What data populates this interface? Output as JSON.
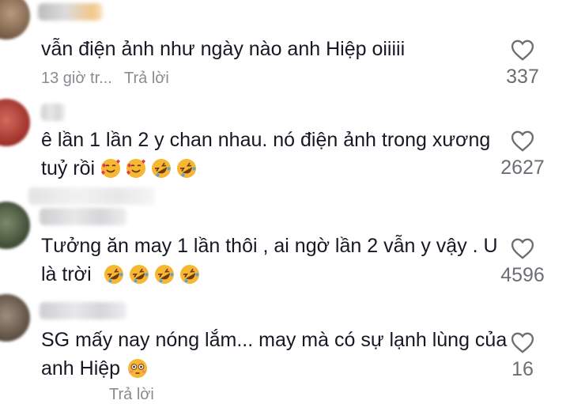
{
  "comments": [
    {
      "text_lines": [
        "vẫn điện ảnh như ngày nào anh Hiệp oiiiii"
      ],
      "time": "13 giờ tr...",
      "reply_label": "Trả lời",
      "likes": "337"
    },
    {
      "text_lines": [
        "ê lần 1 lần 2 y chan nhau. nó điện ảnh trong xương",
        "tuỷ rồi"
      ],
      "emojis": [
        "smiling-face-with-hearts",
        "smiling-face-with-hearts",
        "rolling-on-floor-laughing",
        "rolling-on-floor-laughing"
      ],
      "likes": "2627"
    },
    {
      "text_lines": [
        "Tưởng ăn may 1 lần thôi , ai ngờ lần 2 vẫn y vậy . U",
        "là trời"
      ],
      "emojis": [
        "rolling-on-floor-laughing",
        "rolling-on-floor-laughing",
        "rolling-on-floor-laughing",
        "rolling-on-floor-laughing"
      ],
      "likes": "4596"
    },
    {
      "text_lines": [
        "SG mấy nay nóng lắm... may mà có sự lạnh lùng của",
        "anh Hiệp"
      ],
      "emojis": [
        "flushed-face"
      ],
      "reply_label": "Trả lời",
      "likes": "16"
    }
  ]
}
